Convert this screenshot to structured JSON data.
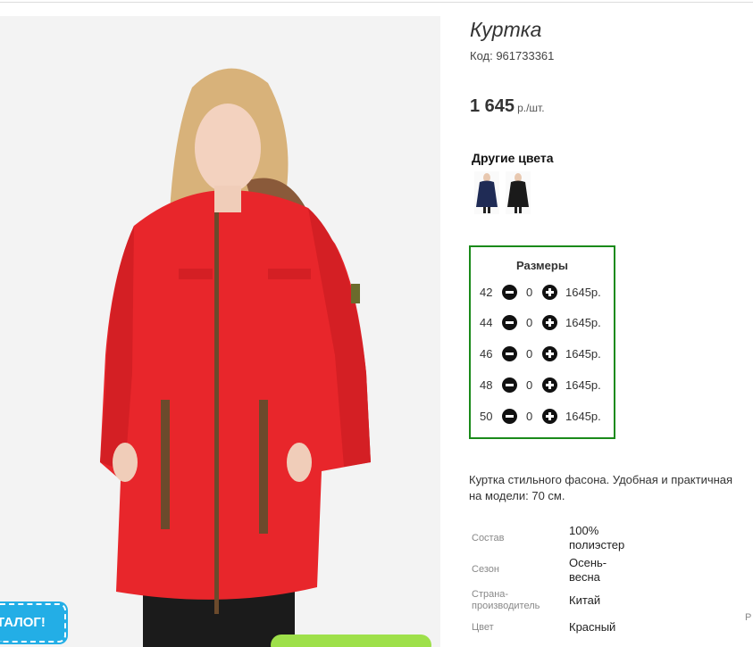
{
  "product": {
    "title": "Куртка",
    "code_line": "Код: 961733361",
    "price": "1 645",
    "price_unit": "р./шт."
  },
  "other_colors": {
    "heading": "Другие цвета",
    "swatches": [
      "navy",
      "black"
    ]
  },
  "sizes": {
    "heading": "Размеры",
    "rows": [
      {
        "size": "42",
        "qty": "0",
        "price": "1645р."
      },
      {
        "size": "44",
        "qty": "0",
        "price": "1645р."
      },
      {
        "size": "46",
        "qty": "0",
        "price": "1645р."
      },
      {
        "size": "48",
        "qty": "0",
        "price": "1645р."
      },
      {
        "size": "50",
        "qty": "0",
        "price": "1645р."
      }
    ]
  },
  "description": {
    "line1": "Куртка стильного фасона. Удобная и практичная",
    "line2": "на модели: 70 см."
  },
  "specs": [
    {
      "label": "Состав",
      "value_line1": "100%",
      "value_line2": "полиэстер"
    },
    {
      "label": "Сезон",
      "value_line1": "Осень-",
      "value_line2": "весна"
    },
    {
      "label_line1": "Страна-",
      "label_line2": "производитель",
      "value": "Китай"
    },
    {
      "label": "Цвет",
      "value": "Красный"
    }
  ],
  "badge": {
    "text": "ТАЛОГ!"
  },
  "edge_letter": "Р",
  "colors": {
    "accent_green": "#1a8a1a",
    "jacket_red": "#e8262b",
    "badge_blue": "#23aee6"
  },
  "icons": [
    "minus-circle-icon",
    "plus-circle-icon"
  ]
}
